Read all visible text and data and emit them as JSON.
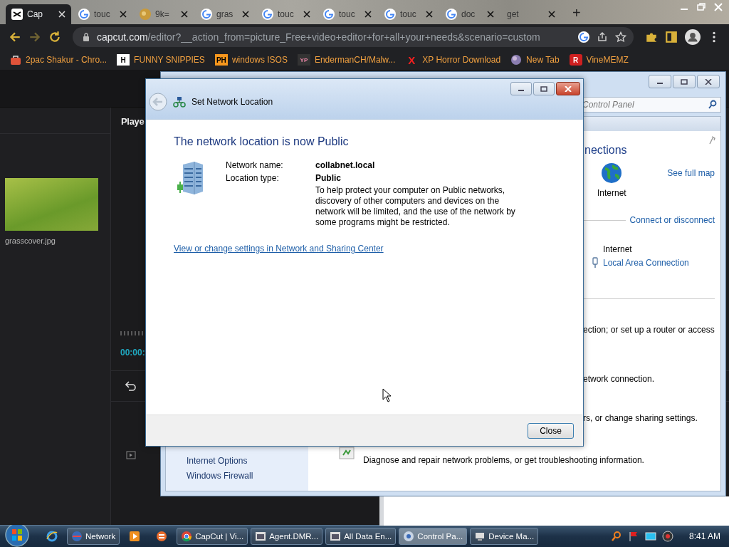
{
  "browser": {
    "tabs": [
      {
        "title": "Cap",
        "kind": "capcut",
        "selected": true
      },
      {
        "title": "touc",
        "kind": "google",
        "selected": false
      },
      {
        "title": "9k=",
        "kind": "image",
        "selected": false
      },
      {
        "title": "gras",
        "kind": "google",
        "selected": false
      },
      {
        "title": "touc",
        "kind": "google",
        "selected": false
      },
      {
        "title": "touc",
        "kind": "google",
        "selected": false
      },
      {
        "title": "touc",
        "kind": "google",
        "selected": false
      },
      {
        "title": "doc",
        "kind": "google",
        "selected": false
      },
      {
        "title": "get",
        "kind": "blank",
        "selected": false
      }
    ],
    "new_tab": "+",
    "url": {
      "domain": "capcut.com",
      "path": "/editor?__action_from=picture_Free+video+editor+for+all+your+needs&scenario=custom"
    },
    "bookmarks": [
      {
        "label": "2pac Shakur - Chro...",
        "kind": "bag"
      },
      {
        "label": "FUNNY SNIPPIES",
        "kind": "light",
        "glyph": "H"
      },
      {
        "label": "windows ISOS",
        "kind": "orange",
        "glyph": "PH"
      },
      {
        "label": "EndermanCH/Malw...",
        "kind": "dark",
        "glyph": "YP"
      },
      {
        "label": "XP Horror Download",
        "kind": "mark",
        "glyph": "X"
      },
      {
        "label": "New Tab",
        "kind": "globe"
      },
      {
        "label": "VineMEMZ",
        "kind": "red",
        "glyph": "R"
      }
    ]
  },
  "editor": {
    "media": [
      {
        "name": "grasscover.jpg"
      }
    ],
    "player_title": "Playe",
    "timecode": "00:00:"
  },
  "control_panel": {
    "search": {
      "placeholder": "Control Panel"
    },
    "heading": "nections",
    "map_node": "Internet",
    "see_full_map": "See full map",
    "connect_link": "Connect or disconnect",
    "network_type": "Internet",
    "connection_link": "Local Area Connection",
    "tasks": [
      "ection; or set up a router or access",
      "etwork connection.",
      "rs, or change sharing settings."
    ],
    "troubleshoot": "Diagnose and repair network problems, or get troubleshooting information.",
    "sidebar": [
      "Internet Options",
      "Windows Firewall"
    ]
  },
  "dialog": {
    "title": "Set Network Location",
    "heading": "The network location is now Public",
    "fields": [
      {
        "label": "Network name:",
        "value": "collabnet.local"
      },
      {
        "label": "Location type:",
        "value": "Public"
      }
    ],
    "description": "To help protect your computer on Public networks, discovery of other computers and devices on the network will be limited, and the use of the network by some programs might be restricted.",
    "link": "View or change settings in Network and Sharing Center",
    "close_button": "Close"
  },
  "taskbar": {
    "items": [
      {
        "kind": "ie",
        "selected": false
      },
      {
        "kind": "network",
        "label": "Network",
        "selected": false
      },
      {
        "kind": "media",
        "selected": false
      },
      {
        "kind": "app",
        "selected": false
      },
      {
        "kind": "chrome",
        "label": "CapCut | Vi...",
        "selected": false
      },
      {
        "kind": "window",
        "label": "Agent.DMR...",
        "selected": false
      },
      {
        "kind": "window",
        "label": "All Data En...",
        "selected": false
      },
      {
        "kind": "control",
        "label": "Control Pa...",
        "selected": true
      },
      {
        "kind": "device",
        "label": "Device Ma...",
        "selected": false
      }
    ],
    "clock": "8:41 AM"
  }
}
